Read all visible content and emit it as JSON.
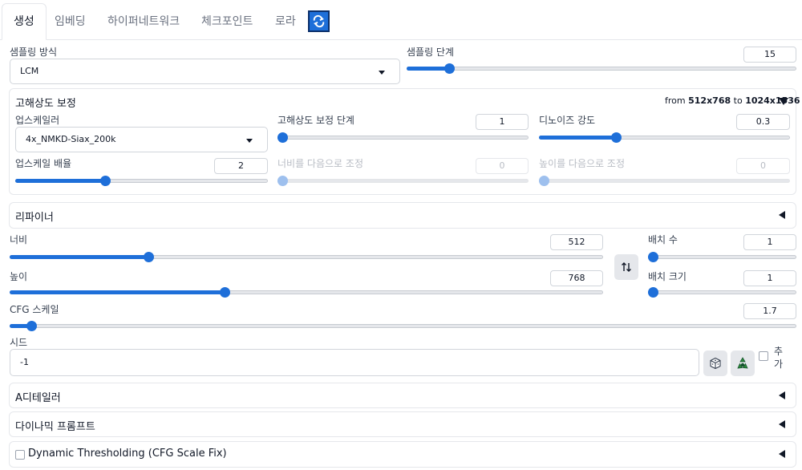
{
  "tabs": [
    {
      "label": "생성",
      "active": true
    },
    {
      "label": "임베딩"
    },
    {
      "label": "하이퍼네트워크"
    },
    {
      "label": "체크포인트"
    },
    {
      "label": "로라"
    }
  ],
  "sampling": {
    "method_label": "샘플링 방식",
    "method_value": "LCM",
    "steps_label": "샘플링 단계",
    "steps_value": "15",
    "steps_fraction": 0.1
  },
  "hires": {
    "title": "고해상도 보정",
    "from_prefix": "from",
    "from_size": "512x768",
    "to_prefix": "to",
    "to_size": "1024x1536",
    "upscaler_label": "업스케일러",
    "upscaler_value": "4x_NMKD-Siax_200k",
    "steps_label": "고해상도 보정 단계",
    "steps_value": "1",
    "steps_fraction": 0.0,
    "denoise_label": "디노이즈 강도",
    "denoise_value": "0.3",
    "denoise_fraction": 0.3,
    "scale_label": "업스케일 배율",
    "scale_value": "2",
    "scale_fraction": 0.35,
    "width_label": "너비를 다음으로 조정",
    "width_value": "0",
    "height_label": "높이를 다음으로 조정",
    "height_value": "0"
  },
  "refiner": {
    "title": "리파이너"
  },
  "size": {
    "width_label": "너비",
    "width_value": "512",
    "width_fraction": 0.23,
    "height_label": "높이",
    "height_value": "768",
    "height_fraction": 0.36,
    "swap_icon": "swap-arrows-icon"
  },
  "batch": {
    "count_label": "배치 수",
    "count_value": "1",
    "count_fraction": 0.0,
    "size_label": "배치 크기",
    "size_value": "1",
    "size_fraction": 0.0
  },
  "cfg": {
    "label": "CFG 스케일",
    "value": "1.7",
    "fraction": 0.022
  },
  "seed": {
    "label": "시드",
    "value": "-1",
    "extra_label_1": "추",
    "extra_label_2": "가",
    "dice_icon": "dice-icon",
    "recycle_icon": "recycle-icon"
  },
  "adetailer": {
    "title": "A디테일러"
  },
  "dynamic_prompts": {
    "title": "다이나믹 프롬프트"
  },
  "dynamic_thresholding": {
    "title": "Dynamic Thresholding (CFG Scale Fix)"
  },
  "colors": {
    "accent": "#1e6fd9",
    "accent_disabled": "#9ec0ee"
  }
}
